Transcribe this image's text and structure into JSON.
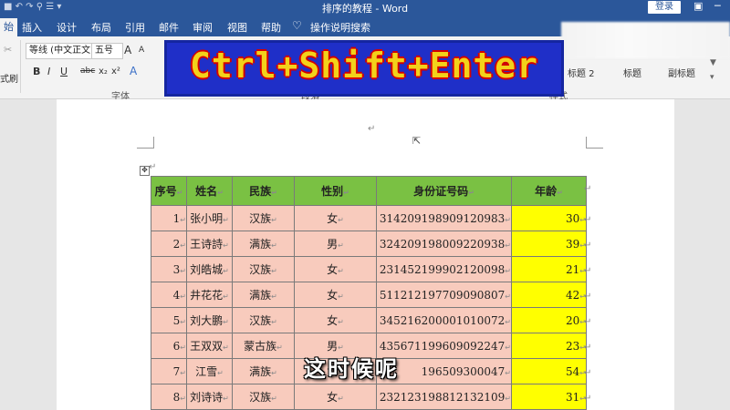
{
  "window": {
    "title": "排序的教程 - Word",
    "login_label": "登录",
    "minimize": "─",
    "restore": "□"
  },
  "tabs": [
    "插入",
    "设计",
    "布局",
    "引用",
    "邮件",
    "审阅",
    "视图",
    "帮助",
    "操作说明搜索"
  ],
  "active_tab_fragment": "始",
  "ribbon": {
    "font_name": "等线 (中文正文",
    "font_size": "五号",
    "group_font": "字体",
    "group_paragraph": "段落",
    "group_styles": "样式",
    "styles": [
      "标题 2",
      "标题",
      "副标题"
    ],
    "left_label": "式刷",
    "format_buttons": [
      "B",
      "I",
      "U",
      "abc",
      "x₂",
      "x²"
    ],
    "font_grow": "A",
    "font_shrink": "A",
    "clear_format": "A"
  },
  "banner": {
    "text": "Ctrl+Shift+Enter"
  },
  "table": {
    "headers": [
      "序号",
      "姓名",
      "民族",
      "性别",
      "身份证号码",
      "年龄"
    ],
    "rows": [
      [
        "1",
        "张小明",
        "汉族",
        "女",
        "314209198909120983",
        "30"
      ],
      [
        "2",
        "王诗詩",
        "满族",
        "男",
        "324209198009220938",
        "39"
      ],
      [
        "3",
        "刘皓城",
        "汉族",
        "女",
        "231452199902120098",
        "21"
      ],
      [
        "4",
        "井花花",
        "满族",
        "女",
        "511212197709090807",
        "42"
      ],
      [
        "5",
        "刘大鹏",
        "汉族",
        "女",
        "345216200001010072",
        "20"
      ],
      [
        "6",
        "王双双",
        "蒙古族",
        "男",
        "435671199609092247",
        "23"
      ],
      [
        "7",
        "江雪",
        "满族",
        "女",
        "196509300047",
        "54"
      ],
      [
        "8",
        "刘诗诗",
        "汉族",
        "女",
        "232123198812132109",
        "31"
      ]
    ]
  },
  "subtitle": "这时候呢",
  "colors": {
    "titlebar": "#2b579a",
    "header_fill": "#7ac143",
    "row_fill": "#f8cbbd",
    "age_fill": "#ffff00",
    "banner_bg": "#1f2fc8",
    "banner_text": "#f3d21a"
  }
}
